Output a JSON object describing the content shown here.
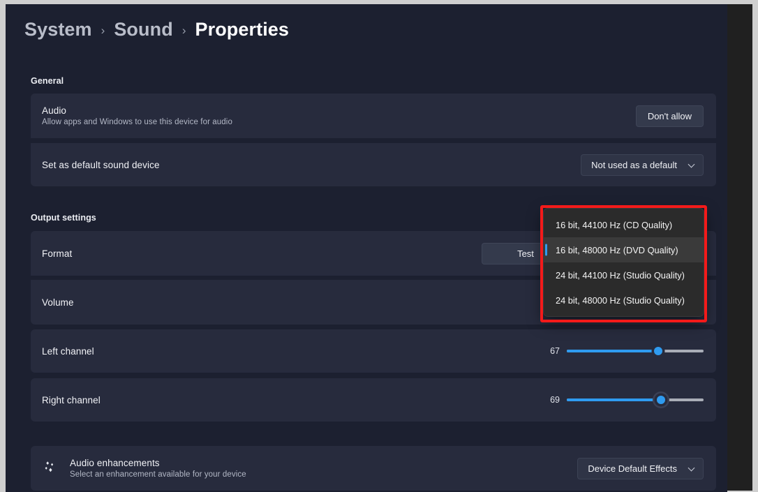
{
  "breadcrumb": {
    "items": [
      {
        "label": "System",
        "current": false
      },
      {
        "label": "Sound",
        "current": false
      },
      {
        "label": "Properties",
        "current": true
      }
    ],
    "separator": "›"
  },
  "sections": {
    "general": {
      "heading": "General",
      "audio": {
        "title": "Audio",
        "subtitle": "Allow apps and Windows to use this device for audio",
        "button_label": "Don't allow"
      },
      "default_device": {
        "title": "Set as default sound device",
        "dropdown_value": "Not used as a default"
      }
    },
    "output": {
      "heading": "Output settings",
      "format": {
        "title": "Format",
        "test_button_label": "Test"
      },
      "volume": {
        "title": "Volume",
        "icon": "speaker-icon"
      },
      "left_channel": {
        "title": "Left channel",
        "value": "67",
        "percent": 67
      },
      "right_channel": {
        "title": "Right channel",
        "value": "69",
        "percent": 69
      },
      "audio_enhancements": {
        "icon": "sparkle-icon",
        "title": "Audio enhancements",
        "subtitle": "Select an enhancement available for your device",
        "dropdown_value": "Device Default Effects"
      }
    }
  },
  "format_dropdown": {
    "open": true,
    "options": [
      {
        "label": "16 bit, 44100 Hz (CD Quality)",
        "selected": false
      },
      {
        "label": "16 bit, 48000 Hz (DVD Quality)",
        "selected": true
      },
      {
        "label": "24 bit, 44100 Hz (Studio Quality)",
        "selected": false
      },
      {
        "label": "24 bit, 48000 Hz (Studio Quality)",
        "selected": false
      }
    ]
  },
  "annotation": {
    "color": "#f31a1a",
    "target": "format-dropdown-flyout"
  },
  "colors": {
    "page_background": "#1c2030",
    "card_background": "#272b3d",
    "accent": "#2f9bf0",
    "flyout_background": "#2b2b2b",
    "flyout_selected": "#3a3a3a",
    "annotation_red": "#f31a1a"
  }
}
